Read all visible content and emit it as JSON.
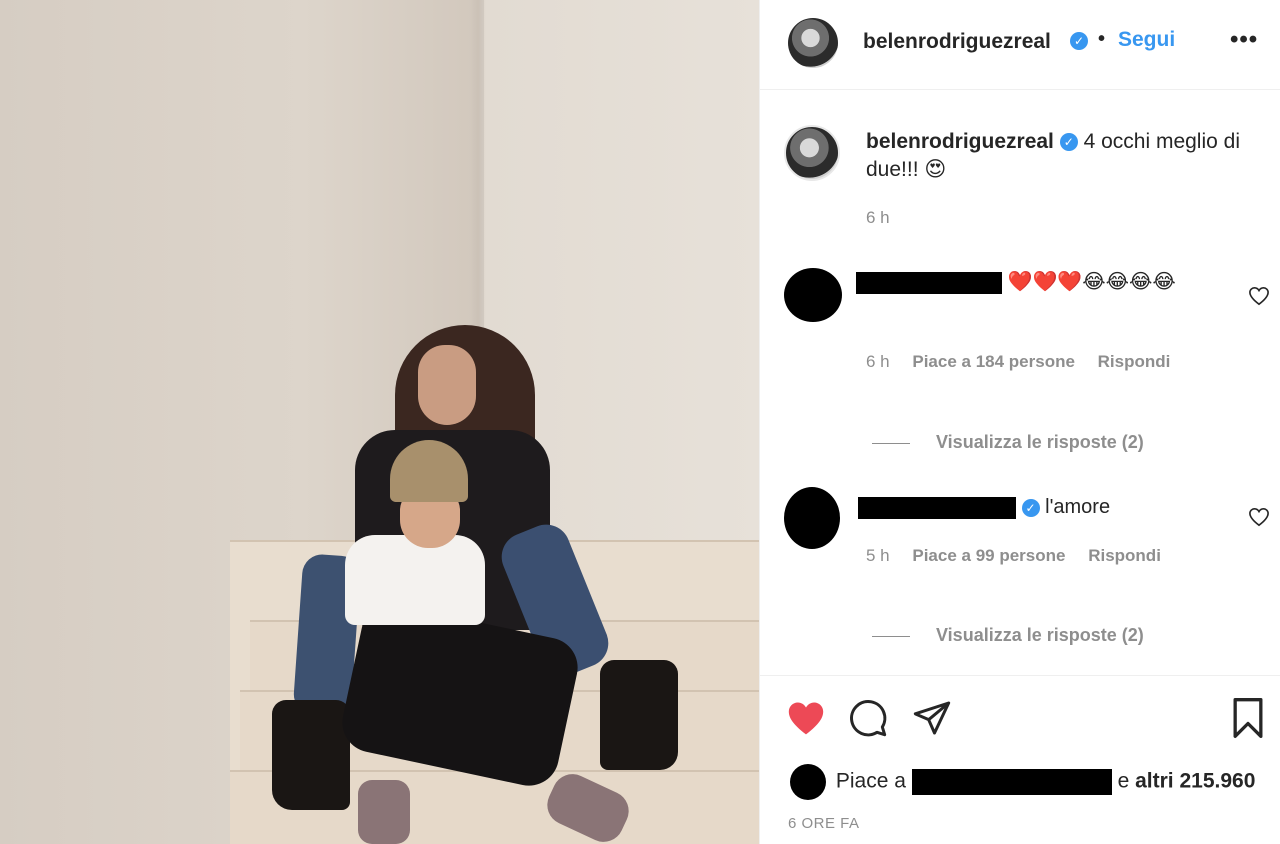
{
  "header": {
    "username": "belenrodriguezreal",
    "verified_mark": "✓",
    "separator": "•",
    "follow_label": "Segui",
    "more_label": "•••"
  },
  "caption": {
    "username": "belenrodriguezreal",
    "text": "4 occhi meglio di due!!! 😍",
    "time": "6 h"
  },
  "comments": [
    {
      "text": "❤️❤️❤️😂😂😂😂",
      "time": "6 h",
      "likes": "Piace a 184 persone",
      "reply_label": "Rispondi",
      "view_replies": "Visualizza le risposte (2)"
    },
    {
      "text": "l'amore",
      "time": "5 h",
      "likes": "Piace a 99 persone",
      "reply_label": "Rispondi",
      "view_replies": "Visualizza le risposte (2)"
    }
  ],
  "likes_summary": {
    "prefix": "Piace a",
    "suffix": "e",
    "others": "altri 215.960"
  },
  "post_time": "6 ORE FA",
  "icons": {
    "like": "heart-filled-icon",
    "comment": "comment-icon",
    "share": "paper-plane-icon",
    "save": "bookmark-icon",
    "comment_like": "heart-outline-icon"
  },
  "colors": {
    "accent": "#3897f0",
    "like_red": "#ed4956",
    "muted": "#8e8e8e",
    "text": "#262626"
  }
}
